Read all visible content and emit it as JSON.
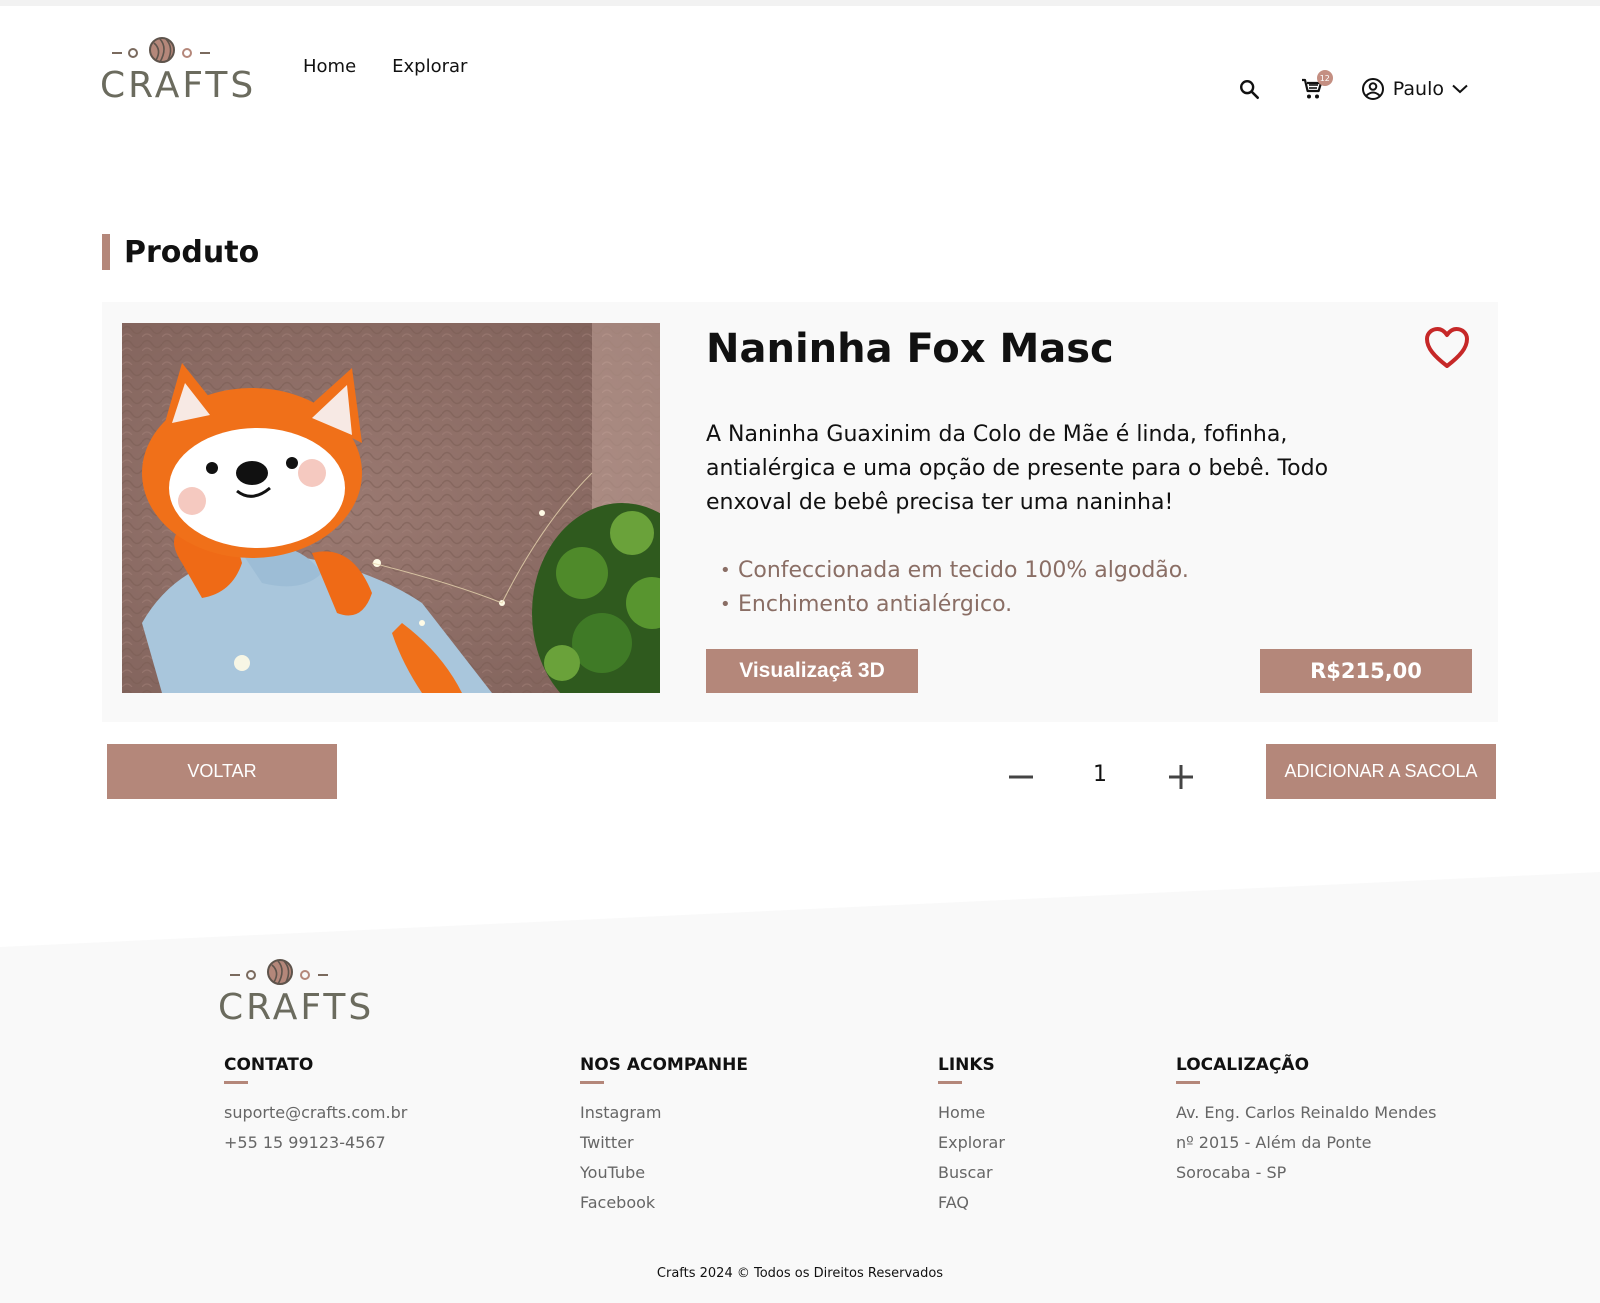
{
  "brand": {
    "logo_text": "CRAFTS"
  },
  "nav": {
    "home": "Home",
    "explore": "Explorar"
  },
  "header": {
    "cart_count": "12",
    "user_name": "Paulo"
  },
  "section": {
    "title": "Produto"
  },
  "product": {
    "name": "Naninha Fox Masc",
    "description": "A Naninha Guaxinim da Colo de Mãe é linda, fofinha, antialérgica e uma opção de presente para o bebê. Todo enxoval de bebê precisa ter uma naninha!",
    "features": [
      "Confeccionada em tecido 100% algodão.",
      "Enchimento antialérgico."
    ],
    "view3d_label": "Visualizaçã 3D",
    "price": "R$215,00"
  },
  "actions": {
    "back_label": "VOLTAR",
    "quantity": "1",
    "add_label": "ADICIONAR A SACOLA"
  },
  "footer": {
    "contact": {
      "title": "CONTATO",
      "items": [
        "suporte@crafts.com.br",
        "+55 15 99123-4567"
      ]
    },
    "social": {
      "title": "NOS ACOMPANHE",
      "items": [
        "Instagram",
        "Twitter",
        "YouTube",
        "Facebook"
      ]
    },
    "links": {
      "title": "LINKS",
      "items": [
        "Home",
        "Explorar",
        "Buscar",
        "FAQ"
      ]
    },
    "location": {
      "title": "LOCALIZAÇÃO",
      "items": [
        "Av. Eng. Carlos Reinaldo Mendes",
        "nº 2015  - Além da Ponte",
        "Sorocaba - SP"
      ]
    },
    "copyright": "Crafts 2024 © Todos os Direitos Reservados"
  },
  "colors": {
    "accent": "#b4877a",
    "card_bg": "#f9f9f9",
    "footer_bg": "#f9f9f9",
    "heart": "#c62828",
    "feature_text": "#8a6e65"
  },
  "icons": [
    "search-icon",
    "cart-icon",
    "user-circle-icon",
    "chevron-down-icon",
    "heart-icon",
    "minus-icon",
    "plus-icon",
    "yarn-ball-icon"
  ]
}
